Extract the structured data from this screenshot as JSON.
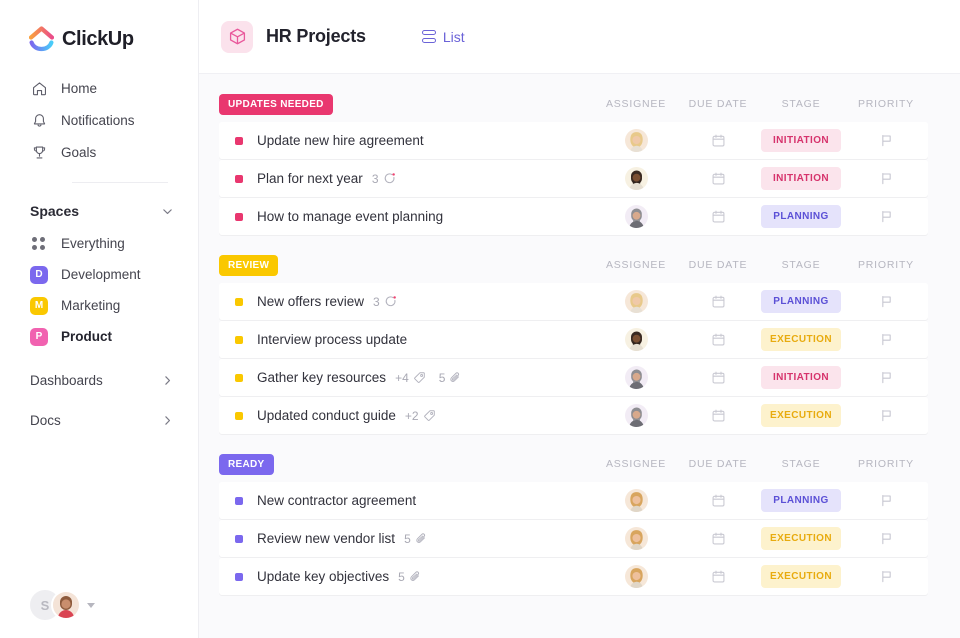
{
  "sidebar": {
    "brand": "ClickUp",
    "nav": [
      {
        "label": "Home",
        "icon": "home-icon"
      },
      {
        "label": "Notifications",
        "icon": "bell-icon"
      },
      {
        "label": "Goals",
        "icon": "trophy-icon"
      }
    ],
    "spaces_heading": "Spaces",
    "spaces": [
      {
        "label": "Everything",
        "icon": "grid-dots-icon",
        "initial": "",
        "color": ""
      },
      {
        "label": "Development",
        "initial": "D",
        "color": "#7b68ee"
      },
      {
        "label": "Marketing",
        "initial": "M",
        "color": "#fac800"
      },
      {
        "label": "Product",
        "initial": "P",
        "color": "#f162b0",
        "active": true
      }
    ],
    "bottom": [
      {
        "label": "Dashboards",
        "icon": "chevron-right-icon"
      },
      {
        "label": "Docs",
        "icon": "chevron-right-icon"
      }
    ],
    "user": {
      "initial": "S",
      "caret": "chevron-down-icon"
    }
  },
  "header": {
    "project_icon": "box-icon",
    "title": "HR Projects",
    "view_tab": {
      "label": "List",
      "icon": "list-view-icon"
    }
  },
  "columns": [
    "ASSIGNEE",
    "DUE DATE",
    "STAGE",
    "PRIORITY"
  ],
  "colors": {
    "updates_needed": "#e9376f",
    "review": "#fac800",
    "ready": "#7b68ee",
    "accent_purple": "#6b63d8",
    "initiation_bg": "#fbe4ec",
    "initiation_fg": "#d6336c",
    "planning_bg": "#e5e3fb",
    "planning_fg": "#5b50d6",
    "execution_bg": "#fdf2cd",
    "execution_fg": "#e8ab0f"
  },
  "groups": [
    {
      "name": "UPDATES NEEDED",
      "badge_color": "#e9376f",
      "dot_color": "#e9376f",
      "tasks": [
        {
          "name": "Update new hire agreement",
          "comments": null,
          "tags": null,
          "attachments": null,
          "stage": "INITIATION",
          "avatar": "female-blonde",
          "avatar_glow": "#d8ecfb",
          "due_icon": "calendar-icon",
          "priority_icon": "flag-icon"
        },
        {
          "name": "Plan for next year",
          "comments": "3",
          "tags": null,
          "attachments": null,
          "stage": "INITIATION",
          "avatar": "male-beard",
          "avatar_glow": "#fcf1cf",
          "due_icon": "calendar-icon",
          "priority_icon": "flag-icon"
        },
        {
          "name": "How to manage event planning",
          "comments": null,
          "tags": null,
          "attachments": null,
          "stage": "PLANNING",
          "avatar": "male-grey",
          "avatar_glow": "#f1e3f7",
          "due_icon": "calendar-icon",
          "priority_icon": "flag-icon"
        }
      ]
    },
    {
      "name": "REVIEW",
      "badge_color": "#fac800",
      "dot_color": "#fac800",
      "tasks": [
        {
          "name": "New offers review",
          "comments": "3",
          "tags": null,
          "attachments": null,
          "stage": "PLANNING",
          "avatar": "female-blonde",
          "avatar_glow": "#d8ecfb",
          "due_icon": "calendar-icon",
          "priority_icon": "flag-icon"
        },
        {
          "name": "Interview process update",
          "comments": null,
          "tags": null,
          "attachments": null,
          "stage": "EXECUTION",
          "avatar": "male-beard",
          "avatar_glow": "#fcf1cf",
          "due_icon": "calendar-icon",
          "priority_icon": "flag-icon"
        },
        {
          "name": "Gather key resources",
          "comments": null,
          "tags": "+4",
          "attachments": "5",
          "stage": "INITIATION",
          "avatar": "male-grey",
          "avatar_glow": "#f1e3f7",
          "due_icon": "calendar-icon",
          "priority_icon": "flag-icon"
        },
        {
          "name": "Updated conduct guide",
          "comments": null,
          "tags": "+2",
          "attachments": null,
          "stage": "EXECUTION",
          "avatar": "male-grey",
          "avatar_glow": "#f1e3f7",
          "due_icon": "calendar-icon",
          "priority_icon": "flag-icon"
        }
      ]
    },
    {
      "name": "READY",
      "badge_color": "#7b68ee",
      "dot_color": "#7b68ee",
      "tasks": [
        {
          "name": "New contractor agreement",
          "comments": null,
          "tags": null,
          "attachments": null,
          "stage": "PLANNING",
          "avatar": "female-blonde",
          "avatar_glow": "#d8ecfb",
          "due_icon": "calendar-icon",
          "priority_icon": "flag-icon"
        },
        {
          "name": "Review new vendor list",
          "comments": null,
          "tags": null,
          "attachments": "5",
          "stage": "EXECUTION",
          "avatar": "female-blonde",
          "avatar_glow": "#d8ecfb",
          "due_icon": "calendar-icon",
          "priority_icon": "flag-icon"
        },
        {
          "name": "Update key objectives",
          "comments": null,
          "tags": null,
          "attachments": "5",
          "stage": "EXECUTION",
          "avatar": "female-blonde",
          "avatar_glow": "#d8ecfb",
          "due_icon": "calendar-icon",
          "priority_icon": "flag-icon"
        }
      ]
    }
  ]
}
